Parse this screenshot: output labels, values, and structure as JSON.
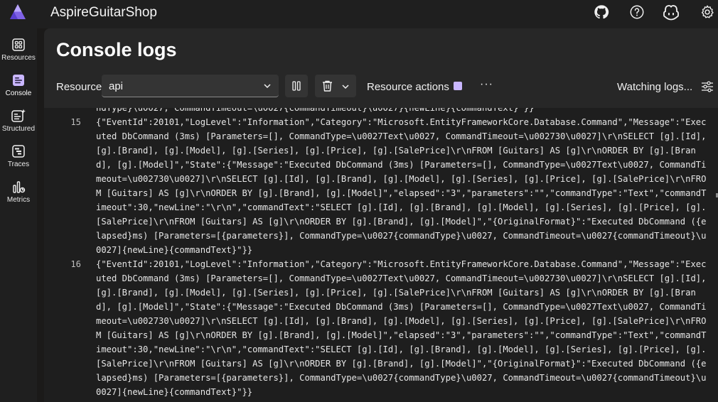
{
  "header": {
    "app_title": "AspireGuitarShop",
    "icons": [
      "aspire-logo-icon",
      "github-icon",
      "help-icon",
      "copilot-icon",
      "settings-icon"
    ]
  },
  "sidebar": {
    "items": [
      {
        "label": "Resources",
        "icon": "resources-icon",
        "active": false
      },
      {
        "label": "Console",
        "icon": "console-icon",
        "active": true
      },
      {
        "label": "Structured",
        "icon": "structured-icon",
        "active": false
      },
      {
        "label": "Traces",
        "icon": "traces-icon",
        "active": false
      },
      {
        "label": "Metrics",
        "icon": "metrics-icon",
        "active": false
      }
    ]
  },
  "page": {
    "title": "Console logs"
  },
  "toolbar": {
    "resource_label": "Resource",
    "resource_value": "api",
    "resource_actions_label": "Resource actions",
    "more_label": "···",
    "watching_label": "Watching logs..."
  },
  "logs": {
    "partial_top": "ndType}\\u0027, CommandTimeout=\\u0027{commandTimeout}\\u0027}{newLine}{commandText}\"}}",
    "entries": [
      {
        "line": "15",
        "text": "{\"EventId\":20101,\"LogLevel\":\"Information\",\"Category\":\"Microsoft.EntityFrameworkCore.Database.Command\",\"Message\":\"Executed DbCommand (3ms) [Parameters=[], CommandType=\\u0027Text\\u0027, CommandTimeout=\\u002730\\u0027]\\r\\nSELECT [g].[Id], [g].[Brand], [g].[Model], [g].[Series], [g].[Price], [g].[SalePrice]\\r\\nFROM [Guitars] AS [g]\\r\\nORDER BY [g].[Brand], [g].[Model]\",\"State\":{\"Message\":\"Executed DbCommand (3ms) [Parameters=[], CommandType=\\u0027Text\\u0027, CommandTimeout=\\u002730\\u0027]\\r\\nSELECT [g].[Id], [g].[Brand], [g].[Model], [g].[Series], [g].[Price], [g].[SalePrice]\\r\\nFROM [Guitars] AS [g]\\r\\nORDER BY [g].[Brand], [g].[Model]\",\"elapsed\":\"3\",\"parameters\":\"\",\"commandType\":\"Text\",\"commandTimeout\":30,\"newLine\":\"\\r\\n\",\"commandText\":\"SELECT [g].[Id], [g].[Brand], [g].[Model], [g].[Series], [g].[Price], [g].[SalePrice]\\r\\nFROM [Guitars] AS [g]\\r\\nORDER BY [g].[Brand], [g].[Model]\",\"{OriginalFormat}\":\"Executed DbCommand ({elapsed}ms) [Parameters=[{parameters}], CommandType=\\u0027{commandType}\\u0027, CommandTimeout=\\u0027{commandTimeout}\\u0027]{newLine}{commandText}\"}}"
      },
      {
        "line": "16",
        "text": "{\"EventId\":20101,\"LogLevel\":\"Information\",\"Category\":\"Microsoft.EntityFrameworkCore.Database.Command\",\"Message\":\"Executed DbCommand (3ms) [Parameters=[], CommandType=\\u0027Text\\u0027, CommandTimeout=\\u002730\\u0027]\\r\\nSELECT [g].[Id], [g].[Brand], [g].[Model], [g].[Series], [g].[Price], [g].[SalePrice]\\r\\nFROM [Guitars] AS [g]\\r\\nORDER BY [g].[Brand], [g].[Model]\",\"State\":{\"Message\":\"Executed DbCommand (3ms) [Parameters=[], CommandType=\\u0027Text\\u0027, CommandTimeout=\\u002730\\u0027]\\r\\nSELECT [g].[Id], [g].[Brand], [g].[Model], [g].[Series], [g].[Price], [g].[SalePrice]\\r\\nFROM [Guitars] AS [g]\\r\\nORDER BY [g].[Brand], [g].[Model]\",\"elapsed\":\"3\",\"parameters\":\"\",\"commandType\":\"Text\",\"commandTimeout\":30,\"newLine\":\"\\r\\n\",\"commandText\":\"SELECT [g].[Id], [g].[Brand], [g].[Model], [g].[Series], [g].[Price], [g].[SalePrice]\\r\\nFROM [Guitars] AS [g]\\r\\nORDER BY [g].[Brand], [g].[Model]\",\"{OriginalFormat}\":\"Executed DbCommand ({elapsed}ms) [Parameters=[{parameters}], CommandType=\\u0027{commandType}\\u0027, CommandTimeout=\\u0027{commandTimeout}\\u0027]{newLine}{commandText}\"}}"
      }
    ]
  },
  "colors": {
    "accent": "#c9b6ff",
    "background": "#1b1a19",
    "panel": "#272727",
    "log_background": "#1e1e1e"
  }
}
